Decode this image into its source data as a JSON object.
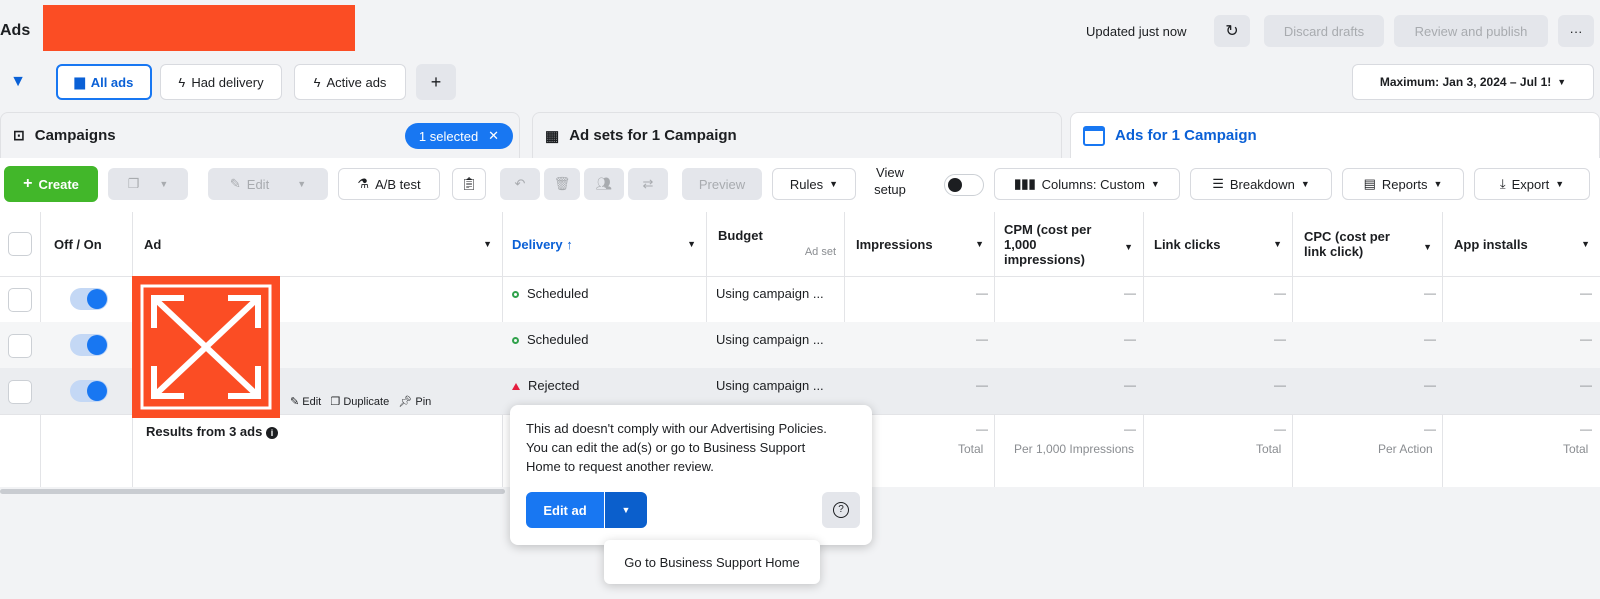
{
  "header": {
    "title": "Ads",
    "updated": "Updated just now",
    "discard_label": "Discard drafts",
    "review_label": "Review and publish",
    "more_label": "···"
  },
  "filters": {
    "all_ads": "All ads",
    "had_delivery": "Had delivery",
    "active_ads": "Active ads",
    "add": "+",
    "date_range": "Maximum: Jan 3, 2024 – Jul 1!"
  },
  "tabs": {
    "campaigns": "Campaigns",
    "selected": "1 selected",
    "adsets": "Ad sets for 1 Campaign",
    "ads": "Ads for 1 Campaign"
  },
  "toolbar": {
    "create": "Create",
    "edit": "Edit",
    "ab_test": "A/B test",
    "preview": "Preview",
    "rules": "Rules",
    "view_setup_1": "View",
    "view_setup_2": "setup",
    "columns": "Columns: Custom",
    "breakdown": "Breakdown",
    "reports": "Reports",
    "export": "Export"
  },
  "table": {
    "headers": {
      "off_on": "Off / On",
      "ad": "Ad",
      "delivery": "Delivery ↑",
      "budget": "Budget",
      "budget_sub": "Ad set",
      "impressions": "Impressions",
      "cpm_1": "CPM (cost per",
      "cpm_2": "1,000",
      "cpm_3": "impressions)",
      "link_clicks": "Link clicks",
      "cpc_1": "CPC (cost per",
      "cpc_2": "link click)",
      "app_installs": "App installs"
    },
    "rows": [
      {
        "delivery": "Scheduled",
        "budget": "Using campaign ..."
      },
      {
        "delivery": "Scheduled",
        "budget": "Using campaign ..."
      },
      {
        "delivery": "Rejected",
        "budget": "Using campaign ..."
      }
    ],
    "row_actions": {
      "edit": "Edit",
      "duplicate": "Duplicate",
      "pin": "Pin"
    },
    "dash": "—",
    "results": {
      "label": "Results from 3 ads",
      "total": "Total",
      "per_1000": "Per 1,000 Impressions",
      "per_action": "Per Action"
    }
  },
  "popup": {
    "line1": "This ad doesn't comply with our Advertising Policies.",
    "line2": "You can edit the ad(s) or go to Business Support",
    "line3": "Home to request another review.",
    "edit_ad": "Edit ad",
    "help": "?",
    "dropdown_item": "Go to Business Support Home"
  },
  "colors": {
    "accent": "#1877f2",
    "create": "#42b72a",
    "redaction": "#fb4d24"
  }
}
